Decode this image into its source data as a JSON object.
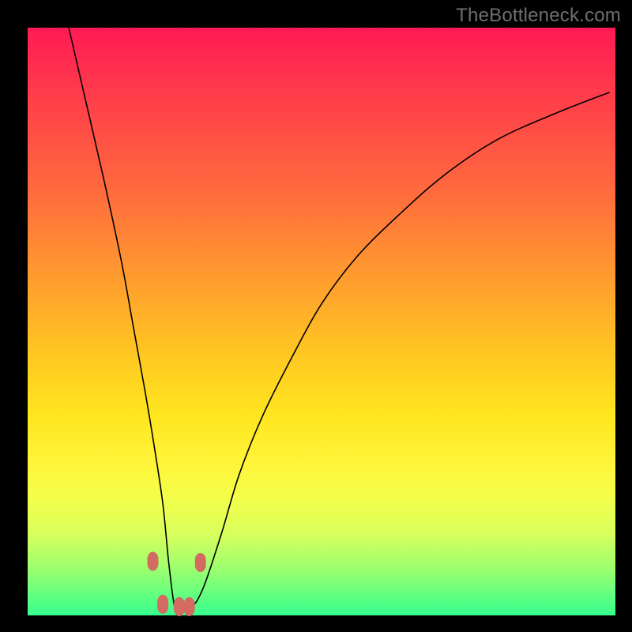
{
  "watermark": "TheBottleneck.com",
  "colors": {
    "frame": "#000000",
    "gradient_top": "#ff1a54",
    "gradient_bottom": "#36ff8e",
    "curve": "#000000",
    "marker": "#d36b63"
  },
  "chart_data": {
    "type": "line",
    "title": "",
    "xlabel": "",
    "ylabel": "",
    "xlim": [
      0,
      100
    ],
    "ylim": [
      0,
      100
    ],
    "grid": false,
    "legend": false,
    "series": [
      {
        "name": "curve",
        "x": [
          7,
          10,
          13,
          16,
          18,
          20,
          21.5,
          23,
          24,
          25,
          26,
          28,
          30,
          33,
          36,
          40,
          45,
          50,
          56,
          63,
          71,
          80,
          90,
          99
        ],
        "values": [
          100,
          87,
          74,
          60,
          49,
          38,
          29,
          19,
          9,
          1.5,
          1.2,
          1.5,
          5,
          14,
          24,
          34,
          44,
          53,
          61,
          68,
          75,
          81,
          85.5,
          89
        ]
      }
    ],
    "markers": [
      {
        "x": 21.3,
        "y": 9.2
      },
      {
        "x": 23.0,
        "y": 1.9
      },
      {
        "x": 25.8,
        "y": 1.5
      },
      {
        "x": 27.5,
        "y": 1.5
      },
      {
        "x": 29.4,
        "y": 9.0
      }
    ]
  }
}
